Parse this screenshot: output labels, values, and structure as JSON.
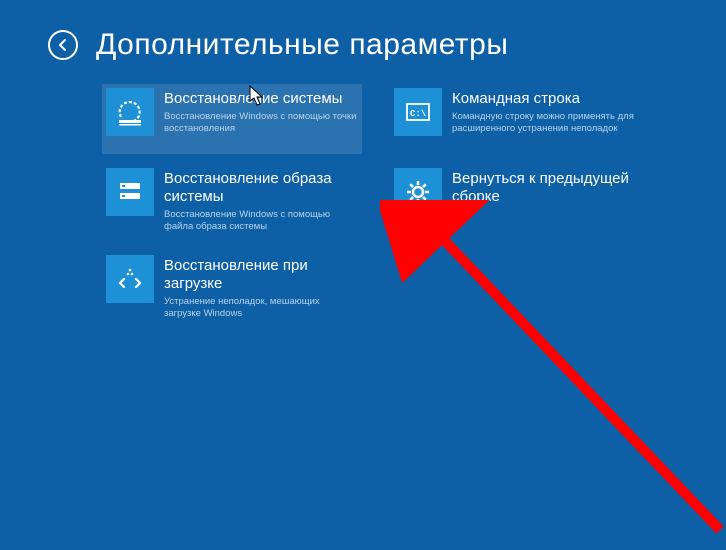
{
  "header": {
    "title": "Дополнительные параметры"
  },
  "tiles": {
    "col1": [
      {
        "title": "Восстановление системы",
        "desc": "Восстановление Windows с помощью точки восстановления",
        "icon": "restore-point"
      },
      {
        "title": "Восстановление образа системы",
        "desc": "Восстановление Windows с помощью файла образа системы",
        "icon": "image-restore"
      },
      {
        "title": "Восстановление при загрузке",
        "desc": "Устранение неполадок, мешающих загрузке Windows",
        "icon": "startup-repair"
      }
    ],
    "col2": [
      {
        "title": "Командная строка",
        "desc": "Командную строку можно применять для расширенного устранения неполадок",
        "icon": "cmd"
      },
      {
        "title": "Вернуться к предыдущей сборке",
        "desc": "",
        "icon": "gear"
      }
    ]
  }
}
